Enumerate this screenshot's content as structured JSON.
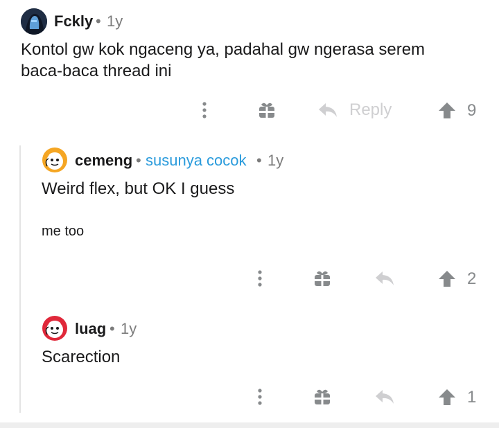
{
  "comment_main": {
    "author": "Fckly",
    "age": "1y",
    "text": "Kontol gw kok ngaceng ya, padahal gw ngerasa serem baca-baca thread ini",
    "reply_label": "Reply",
    "score": "9"
  },
  "comment_reply1": {
    "author": "cemeng",
    "flair": "susunya cocok",
    "age": "1y",
    "text": "Weird flex, but OK I guess",
    "subtext": "me too",
    "score": "2"
  },
  "comment_reply2": {
    "author": "luag",
    "age": "1y",
    "text": "Scarection",
    "score": "1"
  },
  "separator": "•",
  "icons": [
    "more-vertical-icon",
    "gift-icon",
    "reply-arrow-icon",
    "upvote-arrow-icon"
  ],
  "colors": {
    "flair": "#2a9bdc",
    "muted": "#878a8c",
    "icon": "#878a8c",
    "disabled": "#cfcfd1"
  }
}
